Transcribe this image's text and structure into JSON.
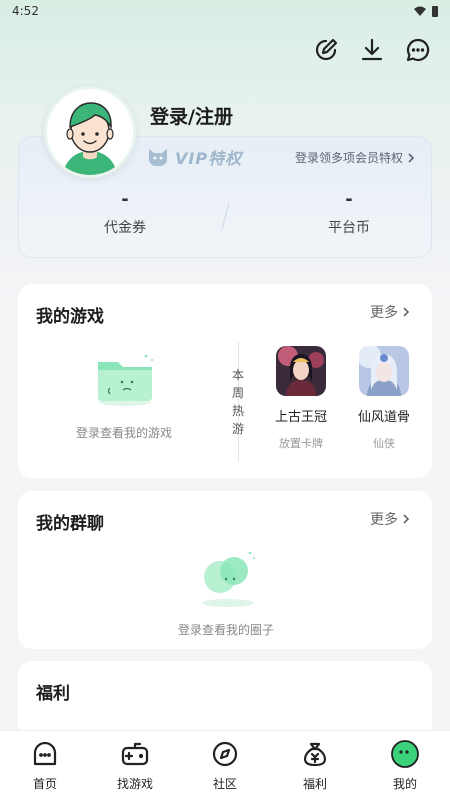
{
  "status": {
    "time": "4:52"
  },
  "header": {
    "icons": [
      "edit-icon",
      "download-icon",
      "message-icon"
    ],
    "login_text": "登录/注册"
  },
  "vip": {
    "badge": "VIP特权",
    "link_text": "登录领多项会员特权",
    "stats": [
      {
        "value": "-",
        "label": "代金券"
      },
      {
        "value": "-",
        "label": "平台币"
      }
    ]
  },
  "my_games": {
    "title": "我的游戏",
    "more": "更多",
    "empty_text": "登录查看我的游戏",
    "weekly_label": [
      "本",
      "周",
      "热",
      "游"
    ],
    "games": [
      {
        "name": "上古王冠",
        "genre": "放置卡牌"
      },
      {
        "name": "仙风道骨",
        "genre": "仙侠"
      }
    ]
  },
  "my_groups": {
    "title": "我的群聊",
    "more": "更多",
    "empty_text": "登录查看我的圈子"
  },
  "welfare": {
    "title": "福利"
  },
  "nav": {
    "items": [
      {
        "label": "首页",
        "icon": "home-icon"
      },
      {
        "label": "找游戏",
        "icon": "gamepad-icon"
      },
      {
        "label": "社区",
        "icon": "compass-icon"
      },
      {
        "label": "福利",
        "icon": "money-bag-icon"
      },
      {
        "label": "我的",
        "icon": "profile-face-icon"
      }
    ],
    "active": "我的",
    "active_color": "#3ad37c"
  }
}
